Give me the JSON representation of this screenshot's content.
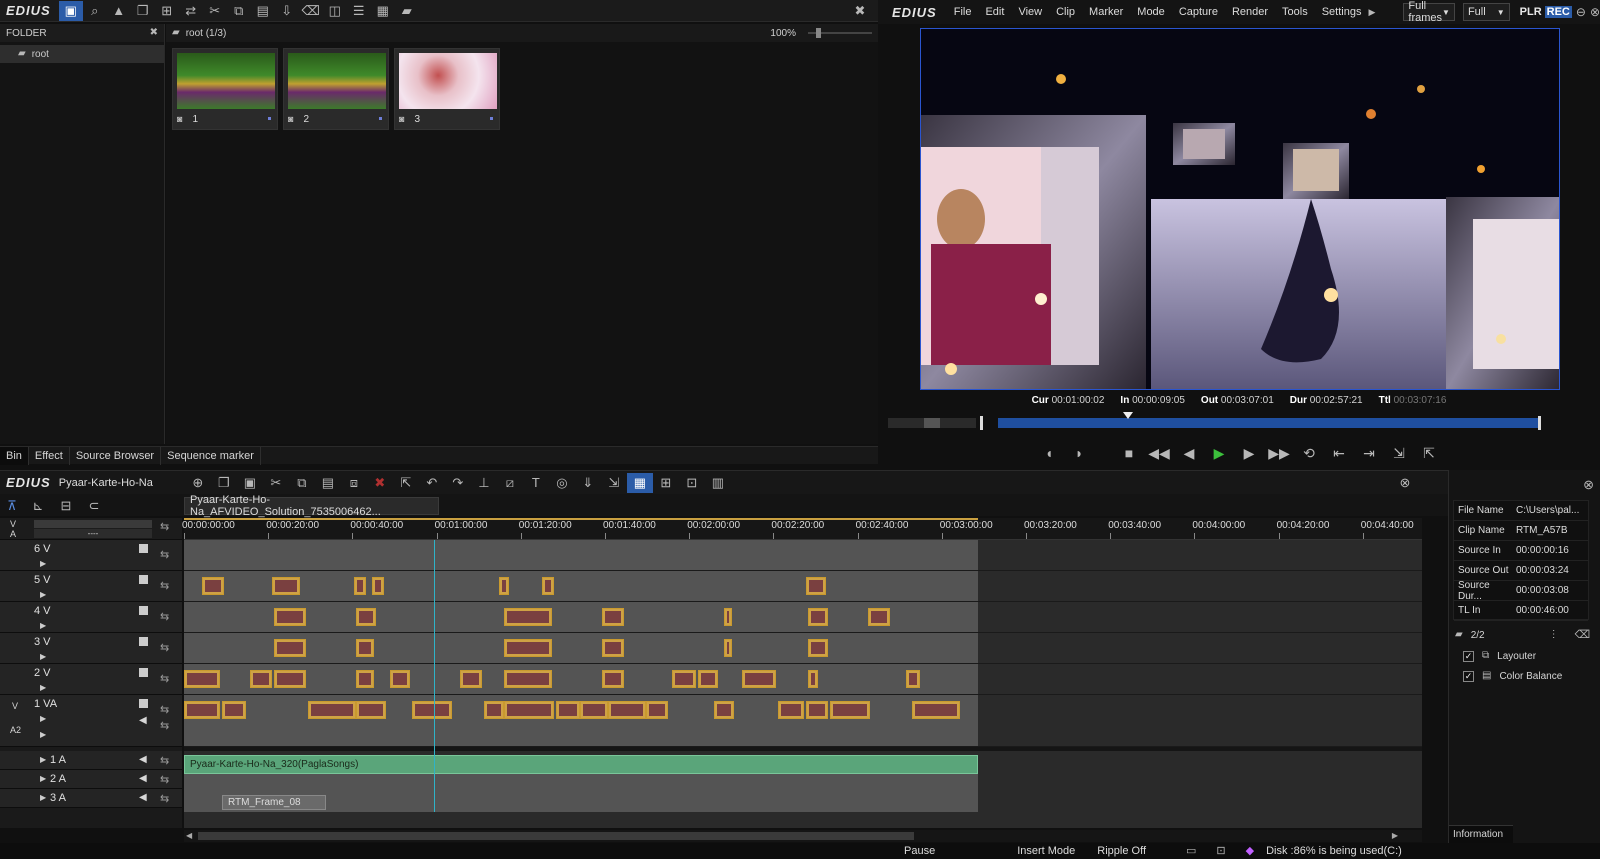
{
  "app": {
    "logo": "EDIUS"
  },
  "bin": {
    "folder_header": "FOLDER",
    "root_label": "root",
    "path_label": "root (1/3)",
    "zoom": "100%",
    "clips": [
      {
        "label": "1"
      },
      {
        "label": "2"
      },
      {
        "label": "3"
      }
    ],
    "tabs": [
      "Bin",
      "Effect",
      "Source Browser",
      "Sequence marker"
    ]
  },
  "player": {
    "menu": [
      "File",
      "Edit",
      "View",
      "Clip",
      "Marker",
      "Mode",
      "Capture",
      "Render",
      "Tools",
      "Settings"
    ],
    "frames_select": "Full frames",
    "quality_select": "Full",
    "plr": "PLR",
    "rec": "REC",
    "timecodes": {
      "cur_label": "Cur",
      "cur": "00:01:00:02",
      "in_label": "In",
      "in": "00:00:09:05",
      "out_label": "Out",
      "out": "00:03:07:01",
      "dur_label": "Dur",
      "dur": "00:02:57:21",
      "ttl_label": "Ttl",
      "ttl": "00:03:07:16"
    },
    "scrub_position": 0.24
  },
  "timeline": {
    "project_name": "Pyaar-Karte-Ho-Na",
    "sequence_tab": "Pyaar-Karte-Ho-Na_AFVIDEO_Solution_7535006462...",
    "ruler": [
      "00:00:00:00",
      "00:00:20:00",
      "00:00:40:00",
      "00:01:00:00",
      "00:01:20:00",
      "00:01:40:00",
      "00:02:00:00",
      "00:02:20:00",
      "00:02:40:00",
      "00:03:00:00",
      "00:03:20:00",
      "00:03:40:00",
      "00:04:00:00",
      "00:04:20:00",
      "00:04:40:00"
    ],
    "patch_v": "V",
    "patch_a": "A",
    "patch_value": "----",
    "tracks": [
      {
        "name": "6 V"
      },
      {
        "name": "5 V"
      },
      {
        "name": "4 V"
      },
      {
        "name": "3 V"
      },
      {
        "name": "2 V"
      },
      {
        "name": "1 VA"
      }
    ],
    "va_label": "V",
    "va_a": "A2",
    "audio_tracks": [
      {
        "name": "1 A"
      },
      {
        "name": "2 A"
      },
      {
        "name": "3 A"
      }
    ],
    "audio_clip": "Pyaar-Karte-Ho-Na_320(PaglaSongs)",
    "frame_clip": "RTM_Frame_08"
  },
  "status": {
    "mode": "Pause",
    "insert": "Insert Mode",
    "ripple": "Ripple Off",
    "disk": "Disk :86% is being used(C:)"
  },
  "info": {
    "rows": [
      {
        "k": "File Name",
        "v": "C:\\Users\\pal..."
      },
      {
        "k": "Clip Name",
        "v": "RTM_A57B"
      },
      {
        "k": "Source In",
        "v": "00:00:00:16"
      },
      {
        "k": "Source Out",
        "v": "00:00:03:24"
      },
      {
        "k": "Source Dur...",
        "v": "00:00:03:08"
      },
      {
        "k": "TL In",
        "v": "00:00:46:00"
      }
    ],
    "count": "2/2",
    "effects": [
      {
        "label": "Layouter"
      },
      {
        "label": "Color Balance"
      }
    ],
    "tab": "Information"
  },
  "colors": {
    "accent": "#2b5ca8",
    "clip": "#cfa245",
    "audio": "#5aa57a",
    "playhead": "#2fb3c8"
  }
}
